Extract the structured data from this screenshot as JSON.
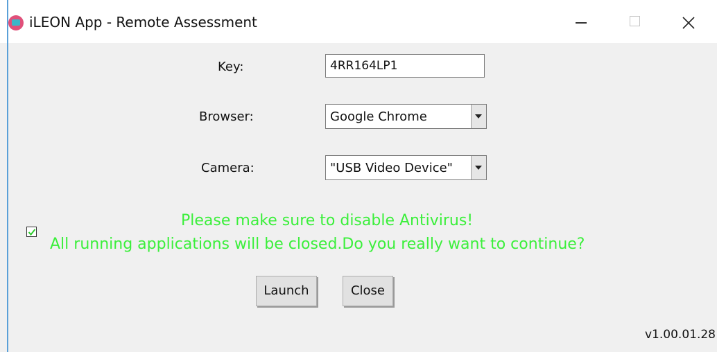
{
  "window": {
    "title": "iLEON App - Remote Assessment",
    "icon": "ileon-app-icon"
  },
  "titlebar_controls": {
    "minimize_icon": "minimize-icon",
    "maximize_icon": "maximize-icon",
    "close_icon": "close-icon"
  },
  "form": {
    "key_label": "Key:",
    "key_value": "4RR164LP1",
    "browser_label": "Browser:",
    "browser_value": "Google Chrome",
    "camera_label": "Camera:",
    "camera_value": "\"USB Video Device\""
  },
  "confirm": {
    "checked": true,
    "warning_line1": "Please make sure to disable Antivirus!",
    "warning_line2": "All running applications will be closed.Do you really want to continue?",
    "warning_color": "#3bef3b"
  },
  "buttons": {
    "launch_label": "Launch",
    "close_label": "Close"
  },
  "footer": {
    "version": "v1.00.01.28"
  }
}
